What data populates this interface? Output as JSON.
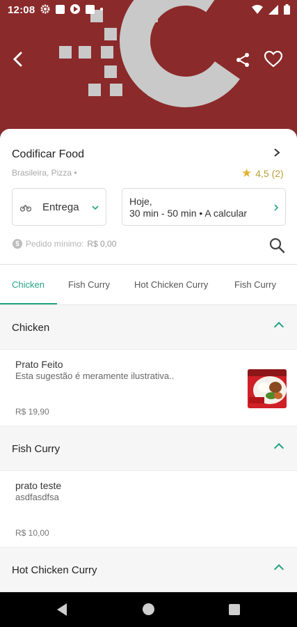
{
  "status_bar": {
    "time": "12:08"
  },
  "store": {
    "name": "Codificar Food",
    "categories": "Brasileira, Pizza •",
    "rating": "4,5 (2)",
    "delivery_mode": "Entrega",
    "schedule_day": "Hoje,",
    "schedule_time": "30 min - 50 min • A calcular",
    "min_order_label": "Pedido mínimo:",
    "min_order_value": "R$ 0,00"
  },
  "tabs": [
    {
      "label": "Chicken",
      "active": true
    },
    {
      "label": "Fish Curry",
      "active": false
    },
    {
      "label": "Hot Chicken Curry",
      "active": false
    },
    {
      "label": "Fish Curry",
      "active": false
    }
  ],
  "sections": [
    {
      "title": "Chicken",
      "items": [
        {
          "name": "Prato Feito",
          "description": "Esta sugestão é meramente ilustrativa..",
          "price": "R$ 19,90"
        }
      ]
    },
    {
      "title": "Fish Curry",
      "items": [
        {
          "name": "prato teste",
          "description": "asdfasdfsa",
          "price": "R$ 10,00"
        }
      ]
    },
    {
      "title": "Hot Chicken Curry",
      "items": []
    }
  ],
  "colors": {
    "brand": "#8b2a2a",
    "accent": "#23a481",
    "star": "#e2b230"
  },
  "icons": [
    "back-arrow-icon",
    "share-icon",
    "heart-icon",
    "bike-icon",
    "chevron-right-icon",
    "search-icon",
    "coin-icon",
    "chevron-up-icon"
  ]
}
